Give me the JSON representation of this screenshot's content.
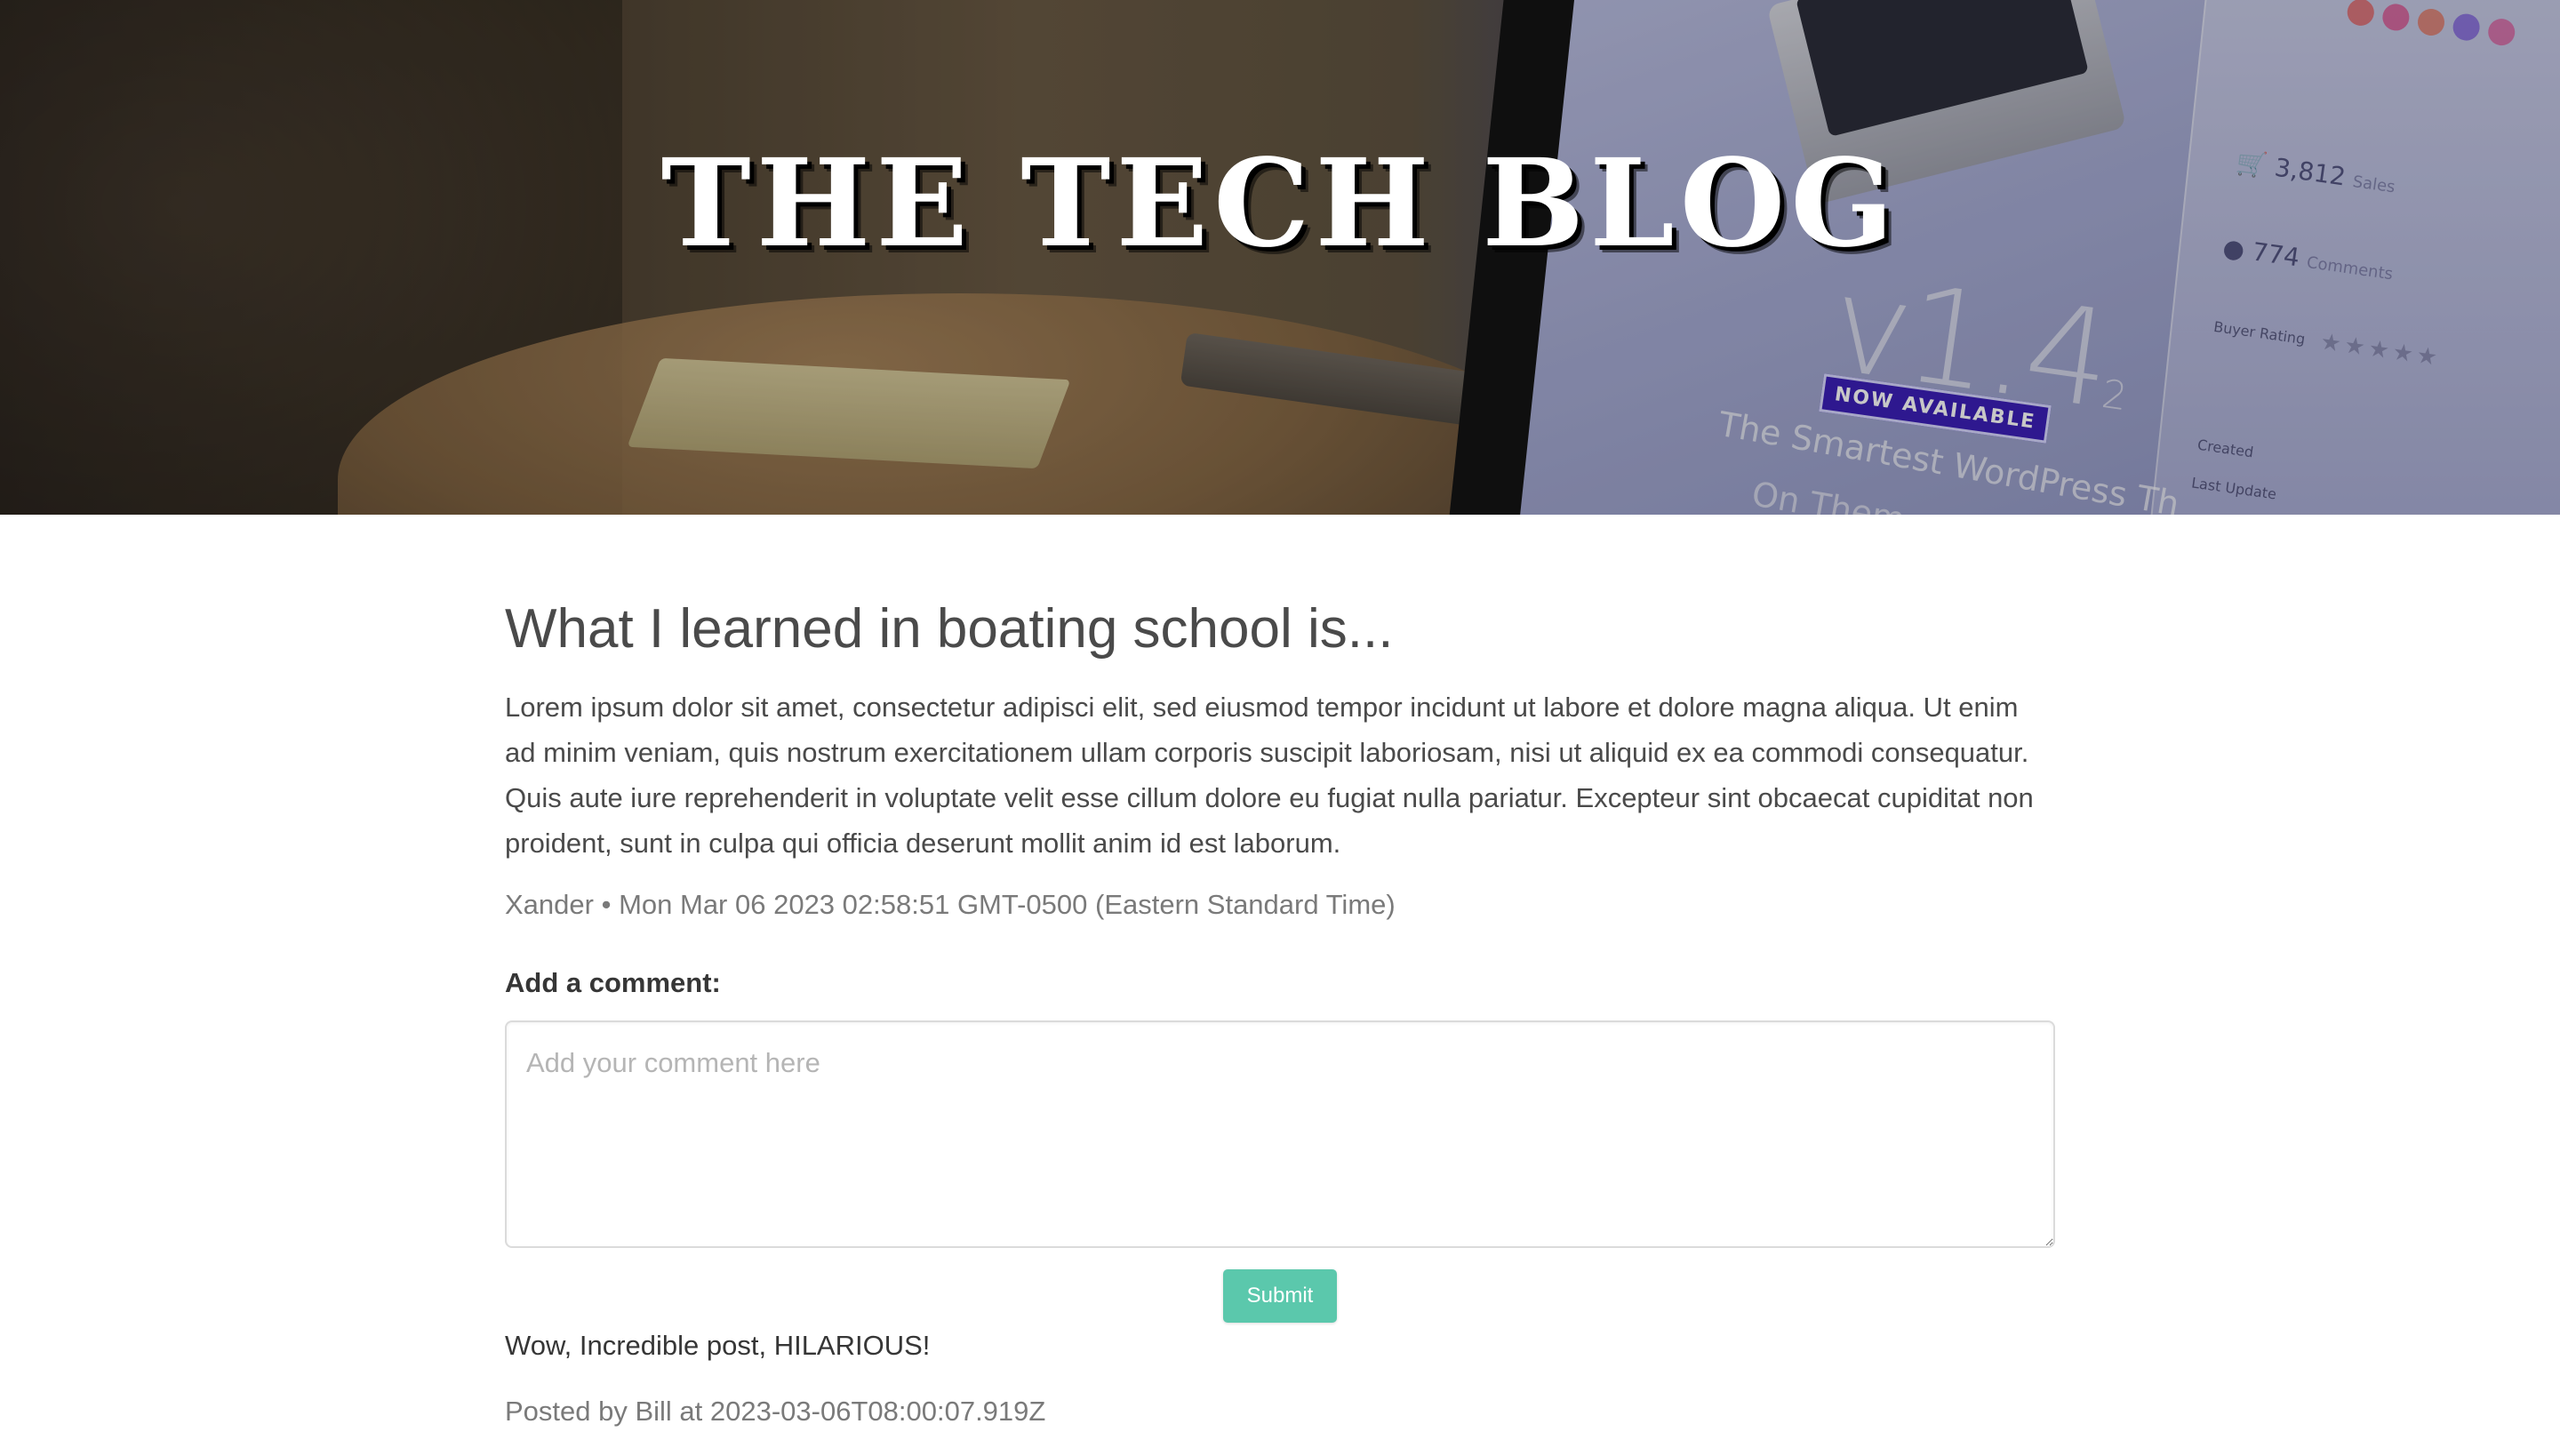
{
  "header": {
    "site_title": "THE TECH BLOG",
    "hero_image": {
      "version_main": "v1.4",
      "version_sub": "2",
      "badge": "NOW AVAILABLE",
      "tagline_line1": "The Smartest WordPress Th",
      "tagline_line2": "On Them",
      "stat_sales": "3,812",
      "stat_sales_label": "Sales",
      "stat_comments": "774",
      "stat_comments_label": "Comments",
      "label_buyer_rating": "Buyer Rating",
      "label_created": "Created",
      "label_last_update": "Last Update",
      "stars": "★★★★★",
      "dot_colors": [
        "#e05a5a",
        "#d94b8a",
        "#e0705a",
        "#7a5ad9",
        "#d95a9a"
      ]
    }
  },
  "post": {
    "title": "What I learned in boating school is...",
    "body": "Lorem ipsum dolor sit amet, consectetur adipisci elit, sed eiusmod tempor incidunt ut labore et dolore magna aliqua. Ut enim ad minim veniam, quis nostrum exercitationem ullam corporis suscipit laboriosam, nisi ut aliquid ex ea commodi consequatur. Quis aute iure reprehenderit in voluptate velit esse cillum dolore eu fugiat nulla pariatur. Excepteur sint obcaecat cupiditat non proident, sunt in culpa qui officia deserunt mollit anim id est laborum.",
    "author": "Xander",
    "separator": "•",
    "date": "Mon Mar 06 2023 02:58:51 GMT-0500 (Eastern Standard Time)"
  },
  "comment_form": {
    "label": "Add a comment:",
    "placeholder": "Add your comment here",
    "value": "",
    "submit_label": "Submit"
  },
  "comments": [
    {
      "text": "Wow, Incredible post, HILARIOUS!",
      "meta": "Posted by Bill at 2023-03-06T08:00:07.919Z"
    }
  ],
  "colors": {
    "submit_button": "#5bc8ac",
    "text_dark": "#4a4a4a",
    "text_muted": "#7a7a7a",
    "badge": "#3b1fb8"
  }
}
